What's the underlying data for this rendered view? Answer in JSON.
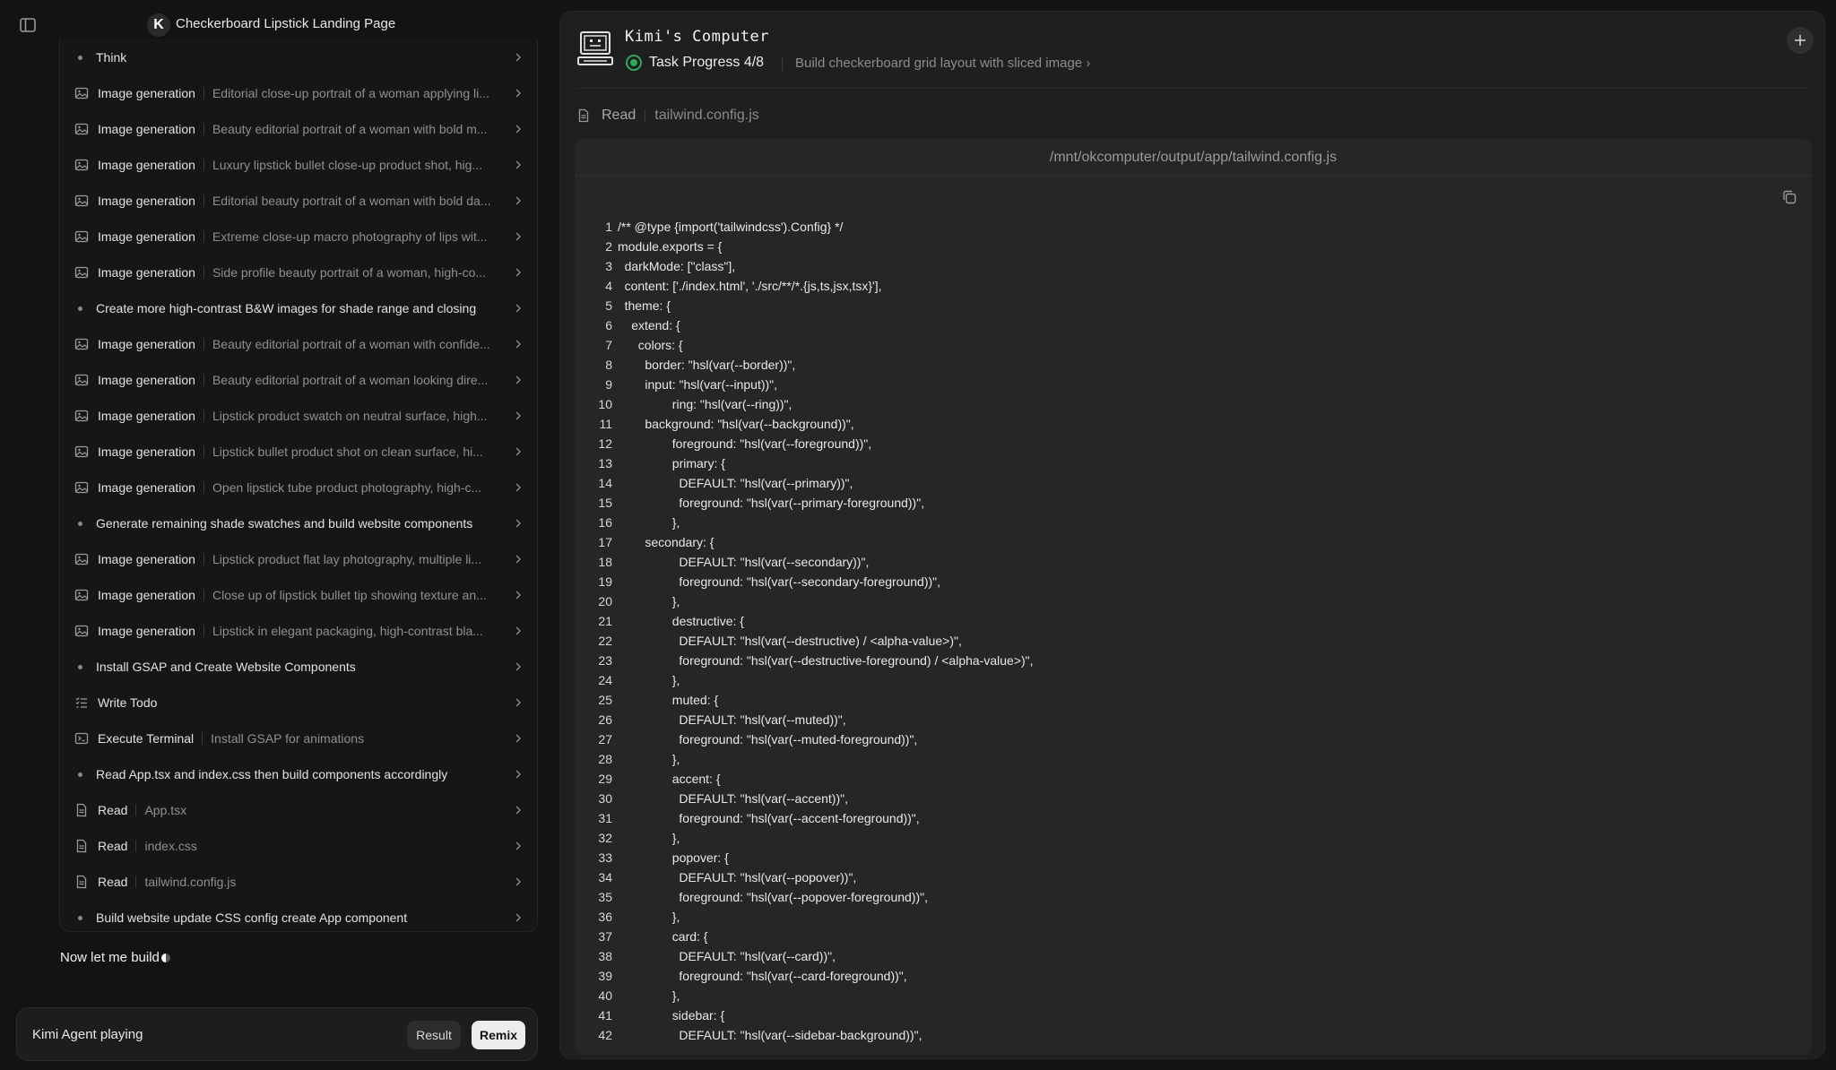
{
  "app": {
    "title": "Checkerboard Lipstick Landing Page",
    "logo_letter": "K"
  },
  "steps": [
    {
      "type": "bullet",
      "label": "Think",
      "desc": ""
    },
    {
      "type": "image",
      "label": "Image generation",
      "desc": "Editorial close-up portrait of a woman applying li..."
    },
    {
      "type": "image",
      "label": "Image generation",
      "desc": "Beauty editorial portrait of a woman with bold m..."
    },
    {
      "type": "image",
      "label": "Image generation",
      "desc": "Luxury lipstick bullet close-up product shot, hig..."
    },
    {
      "type": "image",
      "label": "Image generation",
      "desc": "Editorial beauty portrait of a woman with bold da..."
    },
    {
      "type": "image",
      "label": "Image generation",
      "desc": "Extreme close-up macro photography of lips wit..."
    },
    {
      "type": "image",
      "label": "Image generation",
      "desc": "Side profile beauty portrait of a woman, high-co..."
    },
    {
      "type": "bullet",
      "label": "Create more high-contrast B&W images for shade range and closing",
      "desc": ""
    },
    {
      "type": "image",
      "label": "Image generation",
      "desc": "Beauty editorial portrait of a woman with confide..."
    },
    {
      "type": "image",
      "label": "Image generation",
      "desc": "Beauty editorial portrait of a woman looking dire..."
    },
    {
      "type": "image",
      "label": "Image generation",
      "desc": "Lipstick product swatch on neutral surface, high..."
    },
    {
      "type": "image",
      "label": "Image generation",
      "desc": "Lipstick bullet product shot on clean surface, hi..."
    },
    {
      "type": "image",
      "label": "Image generation",
      "desc": "Open lipstick tube product photography, high-c..."
    },
    {
      "type": "bullet",
      "label": "Generate remaining shade swatches and build website components",
      "desc": ""
    },
    {
      "type": "image",
      "label": "Image generation",
      "desc": "Lipstick product flat lay photography, multiple li..."
    },
    {
      "type": "image",
      "label": "Image generation",
      "desc": "Close up of lipstick bullet tip showing texture an..."
    },
    {
      "type": "image",
      "label": "Image generation",
      "desc": "Lipstick in elegant packaging, high-contrast bla..."
    },
    {
      "type": "bullet",
      "label": "Install GSAP and Create Website Components",
      "desc": ""
    },
    {
      "type": "todo",
      "label": "Write Todo",
      "desc": ""
    },
    {
      "type": "terminal",
      "label": "Execute Terminal",
      "desc": "Install GSAP for animations"
    },
    {
      "type": "bullet",
      "label": "Read App.tsx and index.css then build components accordingly",
      "desc": ""
    },
    {
      "type": "file",
      "label": "Read",
      "desc": "App.tsx"
    },
    {
      "type": "file",
      "label": "Read",
      "desc": "index.css"
    },
    {
      "type": "file",
      "label": "Read",
      "desc": "tailwind.config.js"
    },
    {
      "type": "bullet",
      "label": "Build website update CSS config create App component",
      "desc": ""
    }
  ],
  "status_text": "Now let me build",
  "input_bar": {
    "text": "Kimi Agent playing",
    "result_label": "Result",
    "remix_label": "Remix"
  },
  "computer": {
    "title": "Kimi's Computer",
    "progress_label": "Task Progress 4/8",
    "current_task": "Build checkerboard grid layout with sliced image ›",
    "read_label": "Read",
    "read_file": "tailwind.config.js",
    "file_path": "/mnt/okcomputer/output/app/tailwind.config.js"
  },
  "code": [
    {
      "n": "1",
      "indent": 0,
      "text": "/** @type {import('tailwindcss').Config} */"
    },
    {
      "n": "2",
      "indent": 0,
      "text": "module.exports = {"
    },
    {
      "n": "3",
      "indent": 1,
      "text": "darkMode: [\"class\"],"
    },
    {
      "n": "4",
      "indent": 1,
      "text": "content: ['./index.html', './src/**/*.{js,ts,jsx,tsx}'],"
    },
    {
      "n": "5",
      "indent": 1,
      "text": "theme: {"
    },
    {
      "n": "6",
      "indent": 2,
      "text": "extend: {"
    },
    {
      "n": "7",
      "indent": 3,
      "text": "colors: {"
    },
    {
      "n": "8",
      "indent": 4,
      "text": "border: \"hsl(var(--border))\","
    },
    {
      "n": "9",
      "indent": 4,
      "text": "input: \"hsl(var(--input))\","
    },
    {
      "n": "10",
      "indent": 8,
      "text": "ring: \"hsl(var(--ring))\","
    },
    {
      "n": "11",
      "indent": 4,
      "text": "background: \"hsl(var(--background))\","
    },
    {
      "n": "12",
      "indent": 8,
      "text": "foreground: \"hsl(var(--foreground))\","
    },
    {
      "n": "13",
      "indent": 8,
      "text": "primary: {"
    },
    {
      "n": "14",
      "indent": 9,
      "text": "DEFAULT: \"hsl(var(--primary))\","
    },
    {
      "n": "15",
      "indent": 9,
      "text": "foreground: \"hsl(var(--primary-foreground))\","
    },
    {
      "n": "16",
      "indent": 8,
      "text": "},"
    },
    {
      "n": "17",
      "indent": 4,
      "text": "secondary: {"
    },
    {
      "n": "18",
      "indent": 9,
      "text": "DEFAULT: \"hsl(var(--secondary))\","
    },
    {
      "n": "19",
      "indent": 9,
      "text": "foreground: \"hsl(var(--secondary-foreground))\","
    },
    {
      "n": "20",
      "indent": 8,
      "text": "},"
    },
    {
      "n": "21",
      "indent": 8,
      "text": "destructive: {"
    },
    {
      "n": "22",
      "indent": 9,
      "text": "DEFAULT: \"hsl(var(--destructive) / <alpha-value>)\","
    },
    {
      "n": "23",
      "indent": 9,
      "text": "foreground: \"hsl(var(--destructive-foreground) / <alpha-value>)\","
    },
    {
      "n": "24",
      "indent": 8,
      "text": "},"
    },
    {
      "n": "25",
      "indent": 8,
      "text": "muted: {"
    },
    {
      "n": "26",
      "indent": 9,
      "text": "DEFAULT: \"hsl(var(--muted))\","
    },
    {
      "n": "27",
      "indent": 9,
      "text": "foreground: \"hsl(var(--muted-foreground))\","
    },
    {
      "n": "28",
      "indent": 8,
      "text": "},"
    },
    {
      "n": "29",
      "indent": 8,
      "text": "accent: {"
    },
    {
      "n": "30",
      "indent": 9,
      "text": "DEFAULT: \"hsl(var(--accent))\","
    },
    {
      "n": "31",
      "indent": 9,
      "text": "foreground: \"hsl(var(--accent-foreground))\","
    },
    {
      "n": "32",
      "indent": 8,
      "text": "},"
    },
    {
      "n": "33",
      "indent": 8,
      "text": "popover: {"
    },
    {
      "n": "34",
      "indent": 9,
      "text": "DEFAULT: \"hsl(var(--popover))\","
    },
    {
      "n": "35",
      "indent": 9,
      "text": "foreground: \"hsl(var(--popover-foreground))\","
    },
    {
      "n": "36",
      "indent": 8,
      "text": "},"
    },
    {
      "n": "37",
      "indent": 8,
      "text": "card: {"
    },
    {
      "n": "38",
      "indent": 9,
      "text": "DEFAULT: \"hsl(var(--card))\","
    },
    {
      "n": "39",
      "indent": 9,
      "text": "foreground: \"hsl(var(--card-foreground))\","
    },
    {
      "n": "40",
      "indent": 8,
      "text": "},"
    },
    {
      "n": "41",
      "indent": 8,
      "text": "sidebar: {"
    },
    {
      "n": "42",
      "indent": 9,
      "text": "DEFAULT: \"hsl(var(--sidebar-background))\","
    }
  ],
  "colors": {
    "accent_green": "#2eaa5b",
    "background": "#141414",
    "panel": "#1f1f1f"
  }
}
